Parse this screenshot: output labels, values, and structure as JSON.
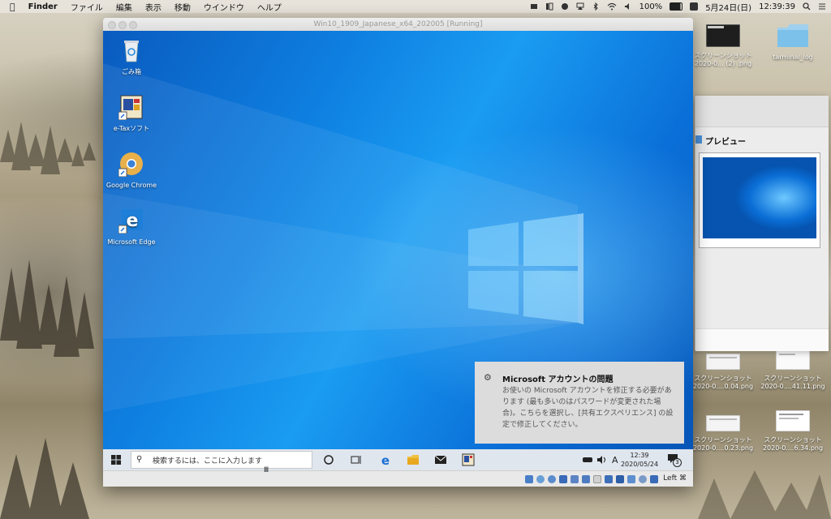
{
  "menubar": {
    "app": "Finder",
    "items": [
      "ファイル",
      "編集",
      "表示",
      "移動",
      "ウインドウ",
      "ヘルプ"
    ],
    "battery": "100%",
    "date": "5月24日(日)",
    "time": "12:39:39"
  },
  "desktop_files": [
    {
      "label": "スクリーンショット\n2020-0... (2) .png"
    },
    {
      "label": "tarminal_log"
    },
    {
      "label": "スクリーンショット\n2020-0....0.04.png"
    },
    {
      "label": "スクリーンショット\n2020-0....41.11.png"
    },
    {
      "label": "スクリーンショット\n2020-0....0.23.png"
    },
    {
      "label": "スクリーンショット\n2020-0....6.34.png"
    }
  ],
  "preview_window": {
    "title": "プレビュー"
  },
  "vm": {
    "title": "Win10_1909_Japanese_x64_202005 [Running]",
    "desktop_icons": [
      {
        "label": "ごみ箱",
        "icon": "recycle-bin-icon"
      },
      {
        "label": "e-Taxソフト",
        "icon": "etax-icon"
      },
      {
        "label": "Google Chrome",
        "icon": "chrome-icon"
      },
      {
        "label": "Microsoft Edge",
        "icon": "edge-icon"
      }
    ],
    "toast": {
      "title": "Microsoft アカウントの問題",
      "body": "お使いの Microsoft アカウントを修正する必要があります (最も多いのはパスワードが変更された場合)。こちらを選択し、[共有エクスペリエンス] の設定で修正してください。"
    },
    "taskbar": {
      "search_placeholder": "検索するには、ここに入力します",
      "ime": "A",
      "clock_time": "12:39",
      "clock_date": "2020/05/24",
      "notification_count": "3"
    },
    "status": {
      "host_key": "Left ⌘"
    }
  },
  "colors": {
    "win_accent": "#0a78d7",
    "taskbar": "#dfe6ee"
  }
}
